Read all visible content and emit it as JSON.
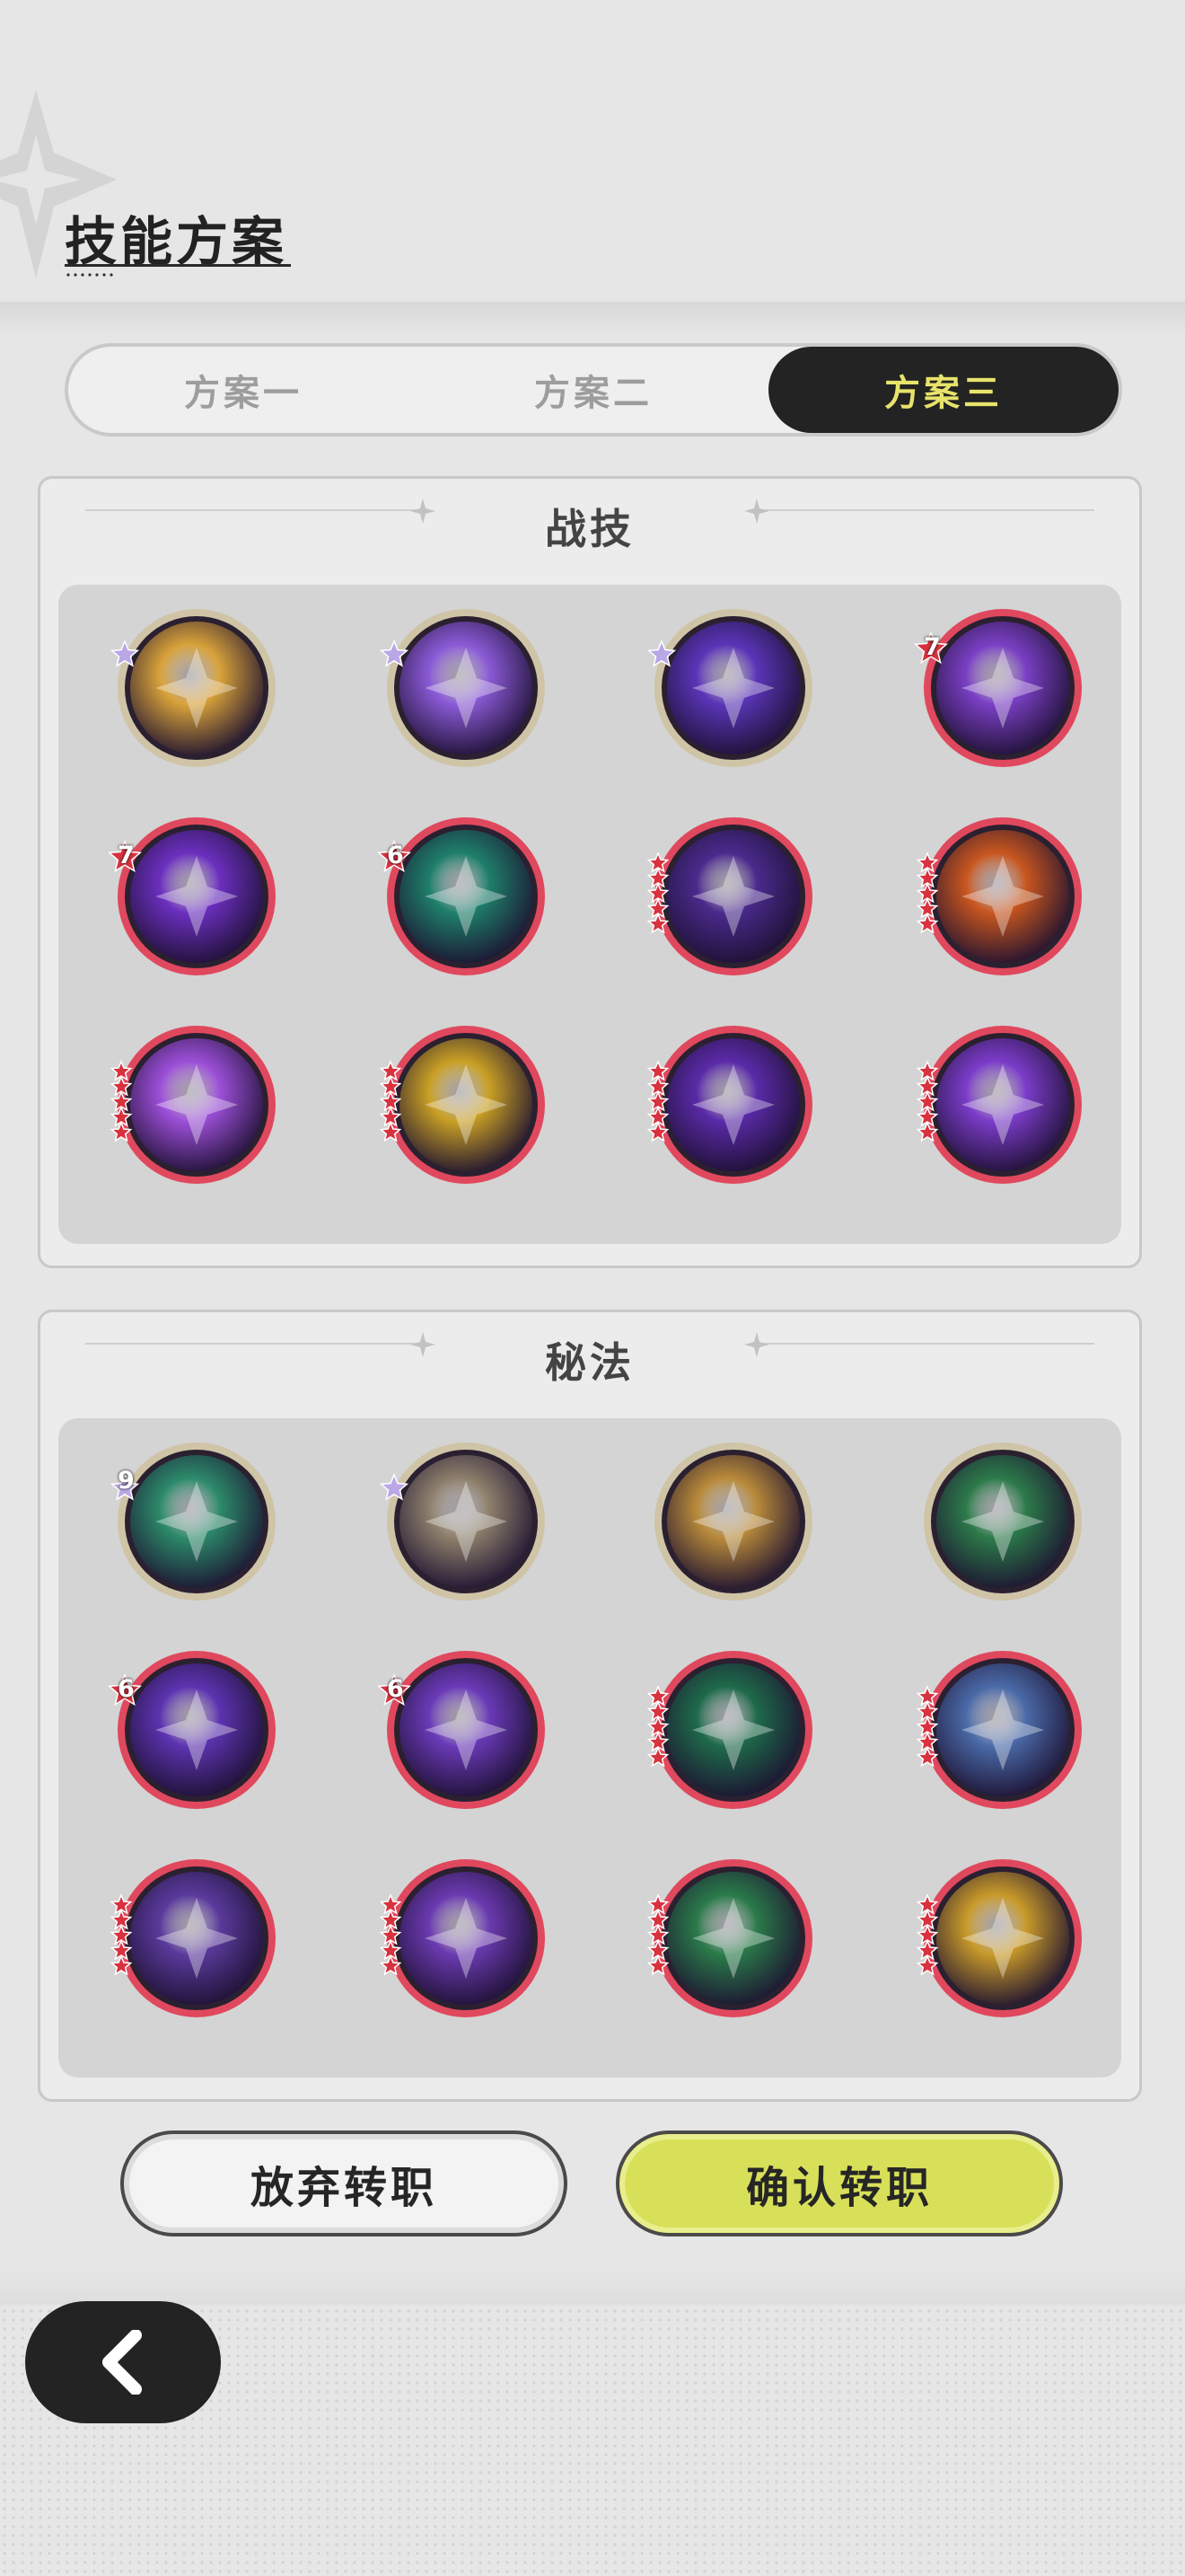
{
  "page": {
    "title": "技能方案"
  },
  "plan_tabs": [
    {
      "label": "方案一",
      "active": false
    },
    {
      "label": "方案二",
      "active": false
    },
    {
      "label": "方案三",
      "active": true
    }
  ],
  "panels": [
    {
      "title": "战技",
      "rows": [
        [
          {
            "icon": "golem-skill-icon",
            "color": "#d8a23a",
            "rim": "#cfc4a6",
            "badge": "star",
            "num": ""
          },
          {
            "icon": "purple-armor-skill-icon",
            "color": "#8a5ad6",
            "rim": "#cfc4a6",
            "badge": "star",
            "num": ""
          },
          {
            "icon": "void-vortex-skill-icon",
            "color": "#5a35b8",
            "rim": "#cfc4a6",
            "badge": "star",
            "num": ""
          },
          {
            "icon": "purple-emblem-skill-icon",
            "color": "#7a3fc4",
            "rim": "#e0485e",
            "badge": "red",
            "num": "7"
          }
        ],
        [
          {
            "icon": "purple-shield-skill-icon",
            "color": "#6b2fbf",
            "rim": "#e0485e",
            "badge": "red",
            "num": "7"
          },
          {
            "icon": "green-spirit-skill-icon",
            "color": "#1e7f6a",
            "rim": "#e0485e",
            "badge": "red",
            "num": "6"
          },
          {
            "icon": "dark-star-skill-icon",
            "color": "#4a2a8c",
            "rim": "#e0485e",
            "badge": "stack",
            "num": ""
          },
          {
            "icon": "orange-totem-skill-icon",
            "color": "#c8561f",
            "rim": "#e0485e",
            "badge": "stack",
            "num": ""
          }
        ],
        [
          {
            "icon": "purple-burst-skill-icon",
            "color": "#9c4fd8",
            "rim": "#e0485e",
            "badge": "stack",
            "num": ""
          },
          {
            "icon": "golden-heal-skill-icon",
            "color": "#c9a025",
            "rim": "#e0485e",
            "badge": "stack",
            "num": ""
          },
          {
            "icon": "purple-eye-skill-icon",
            "color": "#5a2aa8",
            "rim": "#e0485e",
            "badge": "stack",
            "num": ""
          },
          {
            "icon": "purple-hand-skill-icon",
            "color": "#7b3cc9",
            "rim": "#e0485e",
            "badge": "stack",
            "num": ""
          }
        ]
      ]
    },
    {
      "title": "秘法",
      "rows": [
        [
          {
            "icon": "green-figure-arcane-icon",
            "color": "#2c8a6a",
            "rim": "#cfc4a6",
            "badge": "star",
            "num": "9"
          },
          {
            "icon": "gray-figure-arcane-icon",
            "color": "#8d7f6b",
            "rim": "#cfc4a6",
            "badge": "star",
            "num": ""
          },
          {
            "icon": "golden-figure-arcane-icon",
            "color": "#b88a3a",
            "rim": "#cfc4a6",
            "badge": "none",
            "num": ""
          },
          {
            "icon": "green-claw-arcane-icon",
            "color": "#2c7a4a",
            "rim": "#cfc4a6",
            "badge": "none",
            "num": ""
          }
        ],
        [
          {
            "icon": "purple-orb-arcane-icon",
            "color": "#5c33b0",
            "rim": "#e0485e",
            "badge": "red",
            "num": "6"
          },
          {
            "icon": "purple-arm-arcane-icon",
            "color": "#6a3ab8",
            "rim": "#e0485e",
            "badge": "red",
            "num": "6"
          },
          {
            "icon": "green-shield-arcane-icon",
            "color": "#1e6a4a",
            "rim": "#e0485e",
            "badge": "stack",
            "num": ""
          },
          {
            "icon": "blue-armor-arcane-icon",
            "color": "#4a6aa8",
            "rim": "#e0485e",
            "badge": "stack",
            "num": ""
          }
        ],
        [
          {
            "icon": "purple-figure-arcane-icon",
            "color": "#5a3a9c",
            "rim": "#e0485e",
            "badge": "stack",
            "num": ""
          },
          {
            "icon": "purple-fist-arcane-icon",
            "color": "#6a3ab0",
            "rim": "#e0485e",
            "badge": "stack",
            "num": ""
          },
          {
            "icon": "green-wings-arcane-icon",
            "color": "#2a7a4a",
            "rim": "#e0485e",
            "badge": "stack",
            "num": ""
          },
          {
            "icon": "golden-hand-arcane-icon",
            "color": "#c89a2a",
            "rim": "#e0485e",
            "badge": "stack",
            "num": ""
          }
        ]
      ]
    }
  ],
  "buttons": {
    "abandon": "放弃转职",
    "confirm": "确认转职"
  },
  "back_button": {
    "icon": "back-arrow-icon"
  }
}
